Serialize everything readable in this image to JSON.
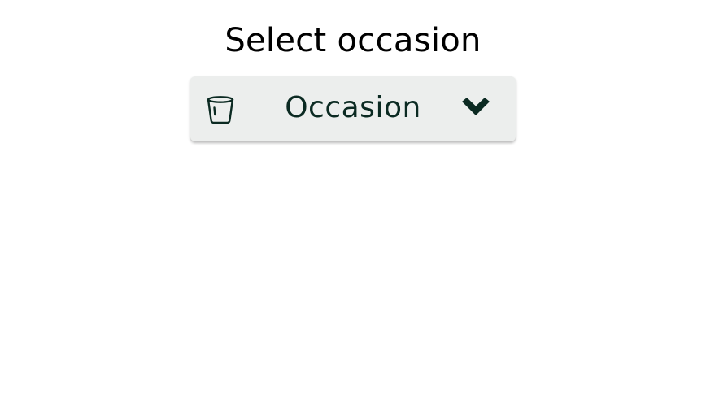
{
  "header": {
    "title": "Select occasion"
  },
  "occasion_select": {
    "value": "Occasion",
    "leading_icon": "cup-icon",
    "trailing_icon": "chevron-down-icon"
  },
  "colors": {
    "title_text": "#000000",
    "select_background": "#eceeed",
    "select_text": "#0b2a22",
    "icon_color": "#0b2a22"
  }
}
